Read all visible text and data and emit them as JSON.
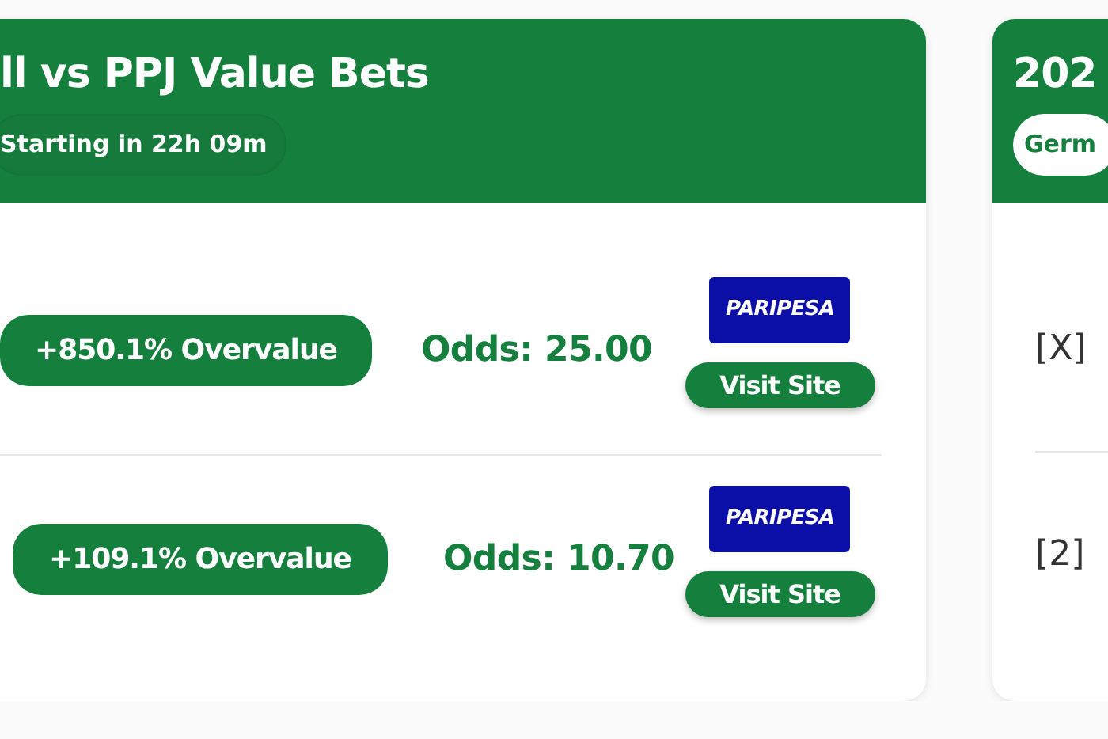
{
  "cards": [
    {
      "title": "ll vs PPJ Value Bets",
      "badge": "Starting in 22h 09m",
      "kind": "dark",
      "rows": [
        {
          "kind": "bet",
          "overvalue": "+850.1% Overvalue",
          "odds": "Odds: 25.00",
          "logo_text": "PARIPESA",
          "button": "Visit Site"
        },
        {
          "kind": "bet",
          "overvalue": "+109.1% Overvalue",
          "odds": "Odds: 10.70",
          "logo_text": "PARIPESA",
          "button": "Visit Site"
        }
      ]
    },
    {
      "title": "202",
      "badge": "Germ",
      "kind": "light",
      "rows": [
        {
          "kind": "pick",
          "label": "[X]"
        },
        {
          "kind": "pick",
          "label": "[2]"
        }
      ]
    }
  ]
}
